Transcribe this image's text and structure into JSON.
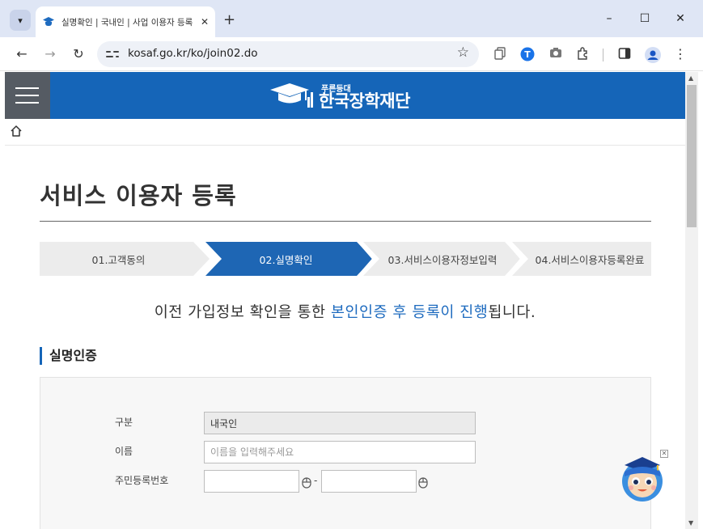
{
  "browser": {
    "tab_title": "실명확인 | 국내인 | 사업 이용자 등록",
    "url": "kosaf.go.kr/ko/join02.do"
  },
  "site": {
    "logo_sub": "푸른등대",
    "logo_name": "한국장학재단",
    "brand_color": "#1565b8"
  },
  "page": {
    "title": "서비스 이용자 등록"
  },
  "steps": [
    {
      "label": "01.고객동의",
      "active": false
    },
    {
      "label": "02.실명확인",
      "active": true
    },
    {
      "label": "03.서비스이용자정보입력",
      "active": false
    },
    {
      "label": "04.서비스이용자등록완료",
      "active": false
    }
  ],
  "intro": {
    "before": "이전 가입정보 확인을 통한 ",
    "highlight": "본인인증 후 등록이 진행",
    "after": "됩니다."
  },
  "section": {
    "title": "실명인증"
  },
  "form": {
    "type_label": "구분",
    "type_value": "내국인",
    "name_label": "이름",
    "name_placeholder": "이름을 입력해주세요",
    "rrn_label": "주민등록번호",
    "rrn_separator": "-"
  },
  "colors": {
    "step_active": "#1e66b4",
    "step_inactive": "#ececec",
    "highlight": "#1e6bbf"
  }
}
